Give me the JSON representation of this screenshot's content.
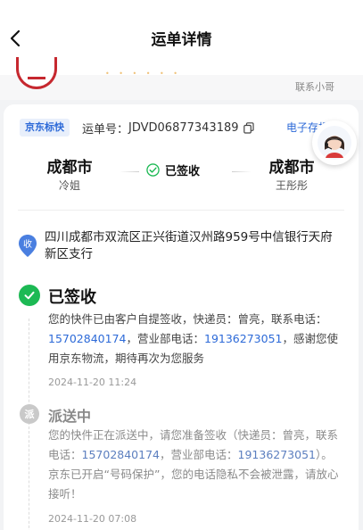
{
  "header": {
    "title": "运单详情"
  },
  "top": {
    "contact_courier": "联系小哥"
  },
  "card": {
    "service_badge": "京东标快",
    "waybill_label": "运单号：",
    "waybill_number": "JDVD06877343189",
    "e_receipt": "电子存根"
  },
  "route": {
    "from_city": "成都市",
    "from_person": "冷姐",
    "status": "已签收",
    "to_city": "成都市",
    "to_person": "王彤彤"
  },
  "address": {
    "pin_label": "收",
    "text": "四川成都市双流区正兴街道汉州路959号中信银行天府新区支行"
  },
  "timeline": [
    {
      "title": "已签收",
      "text_1": "您的快件已由客户自提签收，快递员：曾亮，联系电话：",
      "phone_1": "15702840174",
      "text_2": "，营业部电话：",
      "phone_2": "19136273051",
      "text_3": "，感谢您使用京东物流，期待再次为您服务",
      "time": "2024-11-20 11:24"
    },
    {
      "title": "派送中",
      "node_label": "派",
      "text_1": "您的快件正在派送中，请您准备签收（快递员：曾亮，联系电话：",
      "phone_1": "15702840174",
      "text_2": "，营业部电话：",
      "phone_2": "19136273051",
      "text_3": "）。京东已开启“号码保护”，您的电话隐私不会被泄露，请放心接听！",
      "time": "2024-11-20 07:08"
    }
  ],
  "colors": {
    "accent_blue": "#2d6ad8",
    "success_green": "#1db954",
    "jd_red": "#c6282f"
  },
  "icons": [
    "back-arrow-icon",
    "copy-icon",
    "check-circle-icon",
    "location-pin-icon",
    "customer-service-avatar"
  ]
}
